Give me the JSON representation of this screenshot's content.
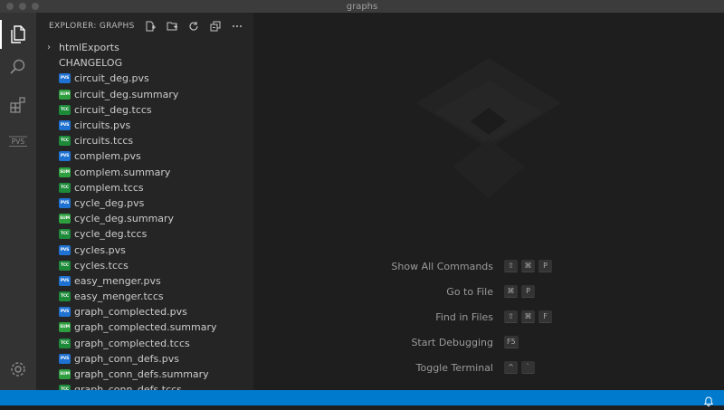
{
  "window": {
    "title": "graphs"
  },
  "activity_bar": {
    "icons": [
      "explorer-icon",
      "search-icon",
      "extensions-icon",
      "pvs-icon",
      "settings-gear-icon"
    ],
    "pvs_label": "PVS"
  },
  "sidebar": {
    "title": "EXPLORER: GRAPHS",
    "actions": [
      "new-file-icon",
      "new-folder-icon",
      "refresh-icon",
      "collapse-all-icon",
      "more-actions-icon"
    ],
    "folder": {
      "label": "htmlExports"
    },
    "plain_file": {
      "label": "CHANGELOG"
    },
    "files": [
      {
        "label": "circuit_deg.pvs",
        "badge": "PVS",
        "kind": "pvs"
      },
      {
        "label": "circuit_deg.summary",
        "badge": "SUM",
        "kind": "sum"
      },
      {
        "label": "circuit_deg.tccs",
        "badge": "TCC",
        "kind": "tcc"
      },
      {
        "label": "circuits.pvs",
        "badge": "PVS",
        "kind": "pvs"
      },
      {
        "label": "circuits.tccs",
        "badge": "TCC",
        "kind": "tcc"
      },
      {
        "label": "complem.pvs",
        "badge": "PVS",
        "kind": "pvs"
      },
      {
        "label": "complem.summary",
        "badge": "SUM",
        "kind": "sum"
      },
      {
        "label": "complem.tccs",
        "badge": "TCC",
        "kind": "tcc"
      },
      {
        "label": "cycle_deg.pvs",
        "badge": "PVS",
        "kind": "pvs"
      },
      {
        "label": "cycle_deg.summary",
        "badge": "SUM",
        "kind": "sum"
      },
      {
        "label": "cycle_deg.tccs",
        "badge": "TCC",
        "kind": "tcc"
      },
      {
        "label": "cycles.pvs",
        "badge": "PVS",
        "kind": "pvs"
      },
      {
        "label": "cycles.tccs",
        "badge": "TCC",
        "kind": "tcc"
      },
      {
        "label": "easy_menger.pvs",
        "badge": "PVS",
        "kind": "pvs"
      },
      {
        "label": "easy_menger.tccs",
        "badge": "TCC",
        "kind": "tcc"
      },
      {
        "label": "graph_complected.pvs",
        "badge": "PVS",
        "kind": "pvs"
      },
      {
        "label": "graph_complected.summary",
        "badge": "SUM",
        "kind": "sum"
      },
      {
        "label": "graph_complected.tccs",
        "badge": "TCC",
        "kind": "tcc"
      },
      {
        "label": "graph_conn_defs.pvs",
        "badge": "PVS",
        "kind": "pvs"
      },
      {
        "label": "graph_conn_defs.summary",
        "badge": "SUM",
        "kind": "sum"
      },
      {
        "label": "graph_conn_defs.tccs",
        "badge": "TCC",
        "kind": "tcc"
      }
    ]
  },
  "editor": {
    "shortcuts": [
      {
        "label": "Show All Commands",
        "keys": [
          "⇧",
          "⌘",
          "P"
        ]
      },
      {
        "label": "Go to File",
        "keys": [
          "⌘",
          "P"
        ]
      },
      {
        "label": "Find in Files",
        "keys": [
          "⇧",
          "⌘",
          "F"
        ]
      },
      {
        "label": "Start Debugging",
        "keys": [
          "F5"
        ]
      },
      {
        "label": "Toggle Terminal",
        "keys": [
          "^",
          "`"
        ]
      }
    ]
  },
  "status_bar": {
    "icons": [
      "bell-icon"
    ]
  },
  "colors": {
    "accent": "#007acc",
    "pvs_badge": "#1f72d1",
    "summary_badge": "#2e9e3e",
    "tcc_badge": "#1d8a3a"
  }
}
